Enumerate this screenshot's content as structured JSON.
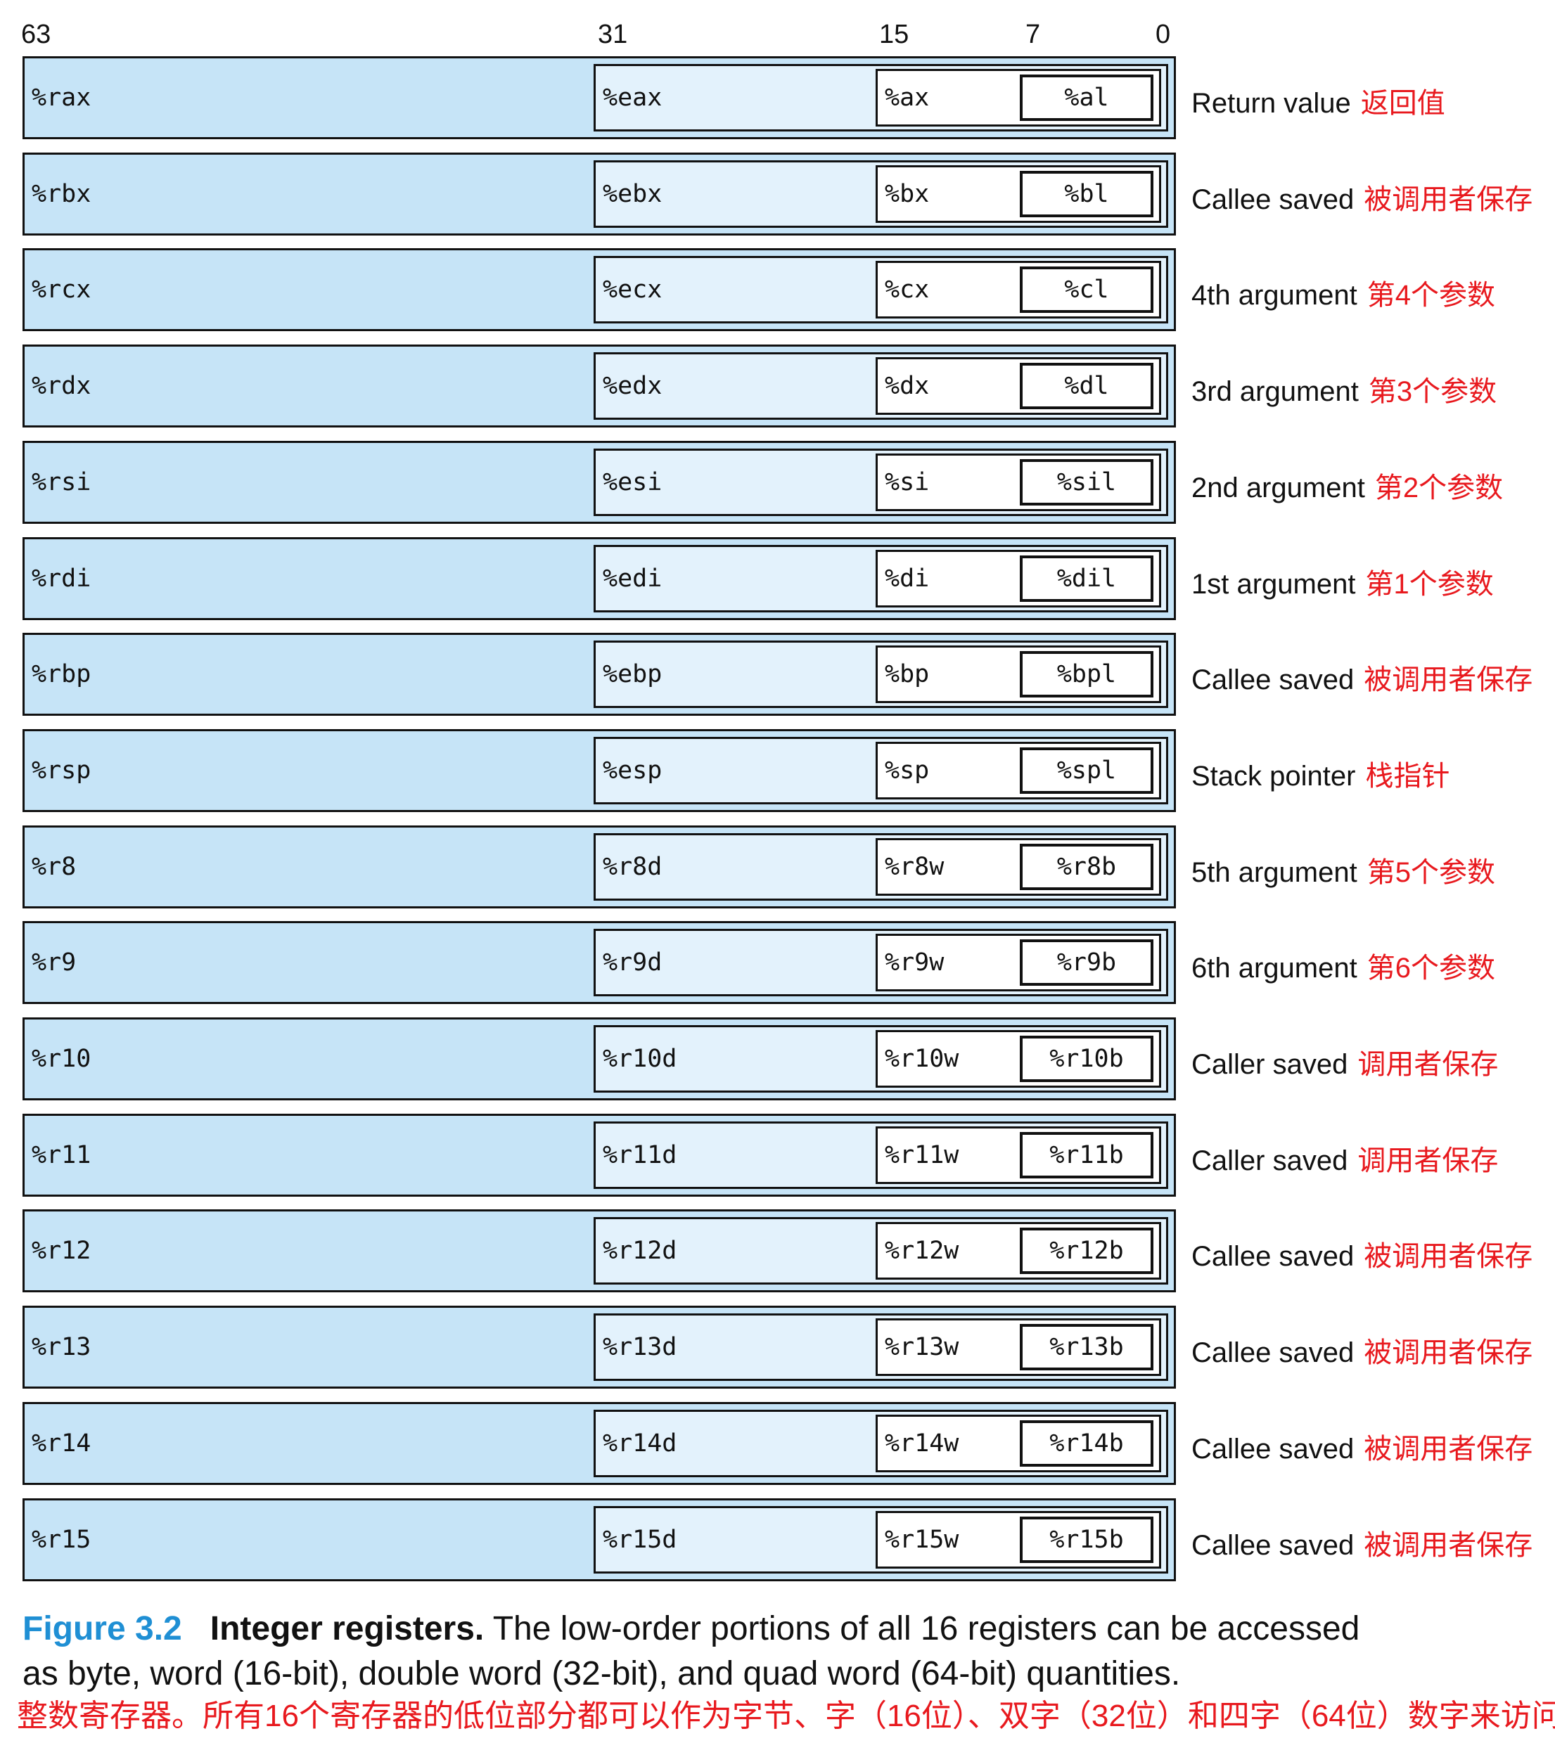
{
  "bit_positions": [
    "63",
    "31",
    "15",
    "7",
    "0"
  ],
  "registers": [
    {
      "r64": "%rax",
      "r32": "%eax",
      "r16": "%ax",
      "r8": "%al",
      "role": "Return value",
      "role_zh": "返回值"
    },
    {
      "r64": "%rbx",
      "r32": "%ebx",
      "r16": "%bx",
      "r8": "%bl",
      "role": "Callee saved",
      "role_zh": "被调用者保存"
    },
    {
      "r64": "%rcx",
      "r32": "%ecx",
      "r16": "%cx",
      "r8": "%cl",
      "role": "4th argument",
      "role_zh": "第4个参数"
    },
    {
      "r64": "%rdx",
      "r32": "%edx",
      "r16": "%dx",
      "r8": "%dl",
      "role": "3rd argument",
      "role_zh": "第3个参数"
    },
    {
      "r64": "%rsi",
      "r32": "%esi",
      "r16": "%si",
      "r8": "%sil",
      "role": "2nd argument",
      "role_zh": "第2个参数"
    },
    {
      "r64": "%rdi",
      "r32": "%edi",
      "r16": "%di",
      "r8": "%dil",
      "role": "1st argument",
      "role_zh": "第1个参数"
    },
    {
      "r64": "%rbp",
      "r32": "%ebp",
      "r16": "%bp",
      "r8": "%bpl",
      "role": "Callee saved",
      "role_zh": "被调用者保存"
    },
    {
      "r64": "%rsp",
      "r32": "%esp",
      "r16": "%sp",
      "r8": "%spl",
      "role": "Stack pointer",
      "role_zh": "栈指针"
    },
    {
      "r64": "%r8",
      "r32": "%r8d",
      "r16": "%r8w",
      "r8": "%r8b",
      "role": "5th argument",
      "role_zh": "第5个参数"
    },
    {
      "r64": "%r9",
      "r32": "%r9d",
      "r16": "%r9w",
      "r8": "%r9b",
      "role": "6th argument",
      "role_zh": "第6个参数"
    },
    {
      "r64": "%r10",
      "r32": "%r10d",
      "r16": "%r10w",
      "r8": "%r10b",
      "role": "Caller saved",
      "role_zh": "调用者保存"
    },
    {
      "r64": "%r11",
      "r32": "%r11d",
      "r16": "%r11w",
      "r8": "%r11b",
      "role": "Caller saved",
      "role_zh": "调用者保存"
    },
    {
      "r64": "%r12",
      "r32": "%r12d",
      "r16": "%r12w",
      "r8": "%r12b",
      "role": "Callee saved",
      "role_zh": "被调用者保存"
    },
    {
      "r64": "%r13",
      "r32": "%r13d",
      "r16": "%r13w",
      "r8": "%r13b",
      "role": "Callee saved",
      "role_zh": "被调用者保存"
    },
    {
      "r64": "%r14",
      "r32": "%r14d",
      "r16": "%r14w",
      "r8": "%r14b",
      "role": "Callee saved",
      "role_zh": "被调用者保存"
    },
    {
      "r64": "%r15",
      "r32": "%r15d",
      "r16": "%r15w",
      "r8": "%r15b",
      "role": "Callee saved",
      "role_zh": "被调用者保存"
    }
  ],
  "caption": {
    "figure_number": "Figure 3.2",
    "title": "Integer registers.",
    "line1_rest": "The low-order portions of all 16 registers can be accessed",
    "line2": "as byte, word (16-bit), double word (32-bit), and quad word (64-bit) quantities.",
    "zh": "整数寄存器。所有16个寄存器的低位部分都可以作为字节、字（16位）、双字（32位）和四字（64位）数字来访问"
  },
  "colors": {
    "quad_fill": "#c6e4f7",
    "double_fill": "#e3f2fc",
    "figure_number": "#1f8fd4",
    "annotation_red": "#e8191e"
  }
}
